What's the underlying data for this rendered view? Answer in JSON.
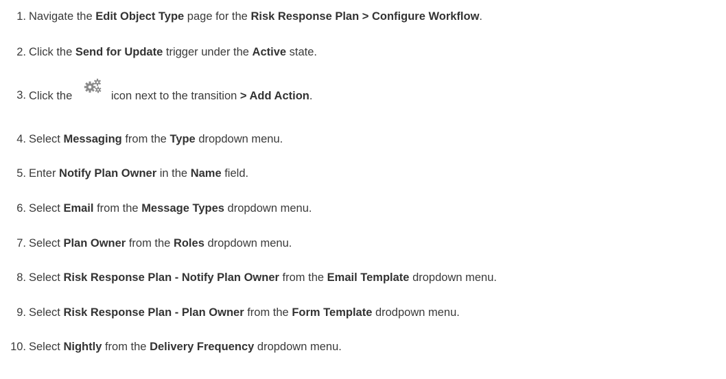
{
  "steps": [
    {
      "num": "1.",
      "parts": [
        {
          "t": "Navigate the ",
          "b": false
        },
        {
          "t": "Edit Object Type",
          "b": true
        },
        {
          "t": " page for the ",
          "b": false
        },
        {
          "t": "Risk Response Plan > Configure Workflow",
          "b": true
        },
        {
          "t": ".",
          "b": false
        }
      ]
    },
    {
      "num": "2.",
      "parts": [
        {
          "t": "Click the ",
          "b": false
        },
        {
          "t": "Send for Update",
          "b": true
        },
        {
          "t": " trigger under the ",
          "b": false
        },
        {
          "t": "Active",
          "b": true
        },
        {
          "t": " state.",
          "b": false
        }
      ]
    },
    {
      "num": "3.",
      "parts": [
        {
          "t": "Click the ",
          "b": false
        },
        {
          "icon": "gears-icon"
        },
        {
          "t": "icon next to the transition ",
          "b": false
        },
        {
          "t": "> Add Action",
          "b": true
        },
        {
          "t": ".",
          "b": false
        }
      ]
    },
    {
      "num": "4.",
      "parts": [
        {
          "t": "Select ",
          "b": false
        },
        {
          "t": "Messaging",
          "b": true
        },
        {
          "t": " from the ",
          "b": false
        },
        {
          "t": "Type",
          "b": true
        },
        {
          "t": " dropdown menu.",
          "b": false
        }
      ]
    },
    {
      "num": "5.",
      "parts": [
        {
          "t": "Enter ",
          "b": false
        },
        {
          "t": "Notify Plan Owner",
          "b": true
        },
        {
          "t": " in the ",
          "b": false
        },
        {
          "t": "Name",
          "b": true
        },
        {
          "t": " field.",
          "b": false
        }
      ]
    },
    {
      "num": "6.",
      "parts": [
        {
          "t": "Select ",
          "b": false
        },
        {
          "t": "Email",
          "b": true
        },
        {
          "t": " from the ",
          "b": false
        },
        {
          "t": "Message Types",
          "b": true
        },
        {
          "t": " dropdown menu.",
          "b": false
        }
      ]
    },
    {
      "num": "7.",
      "parts": [
        {
          "t": "Select ",
          "b": false
        },
        {
          "t": "Plan Owner",
          "b": true
        },
        {
          "t": " from the ",
          "b": false
        },
        {
          "t": "Roles",
          "b": true
        },
        {
          "t": " dropdown menu.",
          "b": false
        }
      ]
    },
    {
      "num": "8.",
      "parts": [
        {
          "t": "Select ",
          "b": false
        },
        {
          "t": "Risk Response Plan - Notify Plan Owner",
          "b": true
        },
        {
          "t": " from the ",
          "b": false
        },
        {
          "t": "Email Template",
          "b": true
        },
        {
          "t": " dropdown menu.",
          "b": false
        }
      ]
    },
    {
      "num": "9.",
      "parts": [
        {
          "t": "Select ",
          "b": false
        },
        {
          "t": "Risk Response Plan - Plan Owner",
          "b": true
        },
        {
          "t": " from the ",
          "b": false
        },
        {
          "t": "Form Template",
          "b": true
        },
        {
          "t": " drodpown menu.",
          "b": false
        }
      ]
    },
    {
      "num": "10.",
      "parts": [
        {
          "t": "Select ",
          "b": false
        },
        {
          "t": "Nightly",
          "b": true
        },
        {
          "t": " from the ",
          "b": false
        },
        {
          "t": "Delivery Frequency",
          "b": true
        },
        {
          "t": " dropdown menu.",
          "b": false
        }
      ]
    }
  ],
  "colors": {
    "text": "#3a3a3a",
    "icon": "#8a8a8a"
  }
}
